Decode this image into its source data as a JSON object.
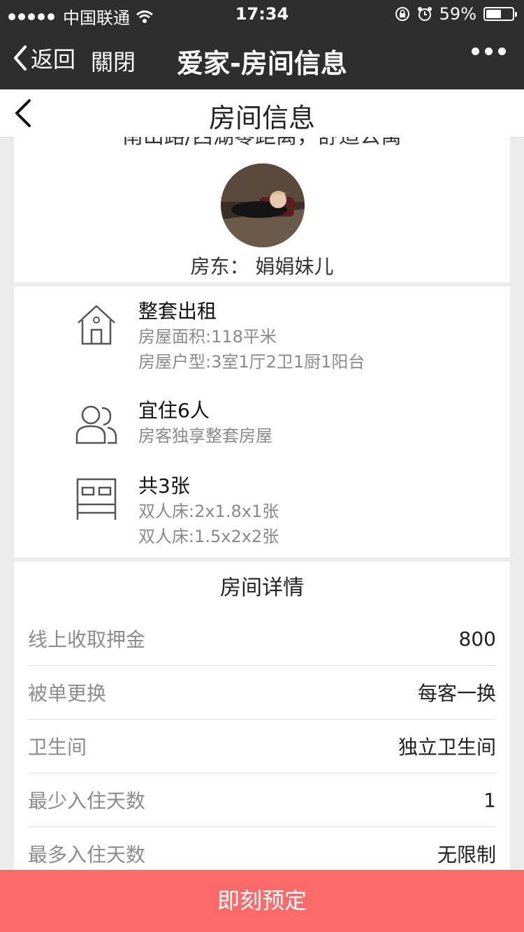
{
  "status_bar": {
    "carrier": "中国联通",
    "time": "17:34",
    "battery": "59%",
    "battery_level": 0.59
  },
  "nav": {
    "back_label": "返回",
    "close_label": "關閉",
    "title": "爱家-房间信息"
  },
  "page": {
    "title": "房间信息"
  },
  "room": {
    "name": "南山路/西湖零距离，舒适公寓",
    "host_label": "房东：",
    "host_name": "娟娟妹儿"
  },
  "features": [
    {
      "icon": "house-icon",
      "title": "整套出租",
      "lines": [
        "房屋面积:118平米",
        "房屋户型:3室1厅2卫1厨1阳台"
      ]
    },
    {
      "icon": "guests-icon",
      "title": "宜住6人",
      "lines": [
        "房客独享整套房屋"
      ]
    },
    {
      "icon": "bed-icon",
      "title": "共3张",
      "lines": [
        "双人床:2x1.8x1张",
        "双人床:1.5x2x2张"
      ]
    }
  ],
  "details": {
    "title": "房间详情",
    "rows": [
      {
        "label": "线上收取押金",
        "value": "800"
      },
      {
        "label": "被单更换",
        "value": "每客一换"
      },
      {
        "label": "卫生间",
        "value": "独立卫生间"
      },
      {
        "label": "最少入住天数",
        "value": "1"
      },
      {
        "label": "最多入住天数",
        "value": "无限制"
      }
    ]
  },
  "book_button": {
    "label": "即刻预定",
    "color": "#fd6a6a"
  }
}
